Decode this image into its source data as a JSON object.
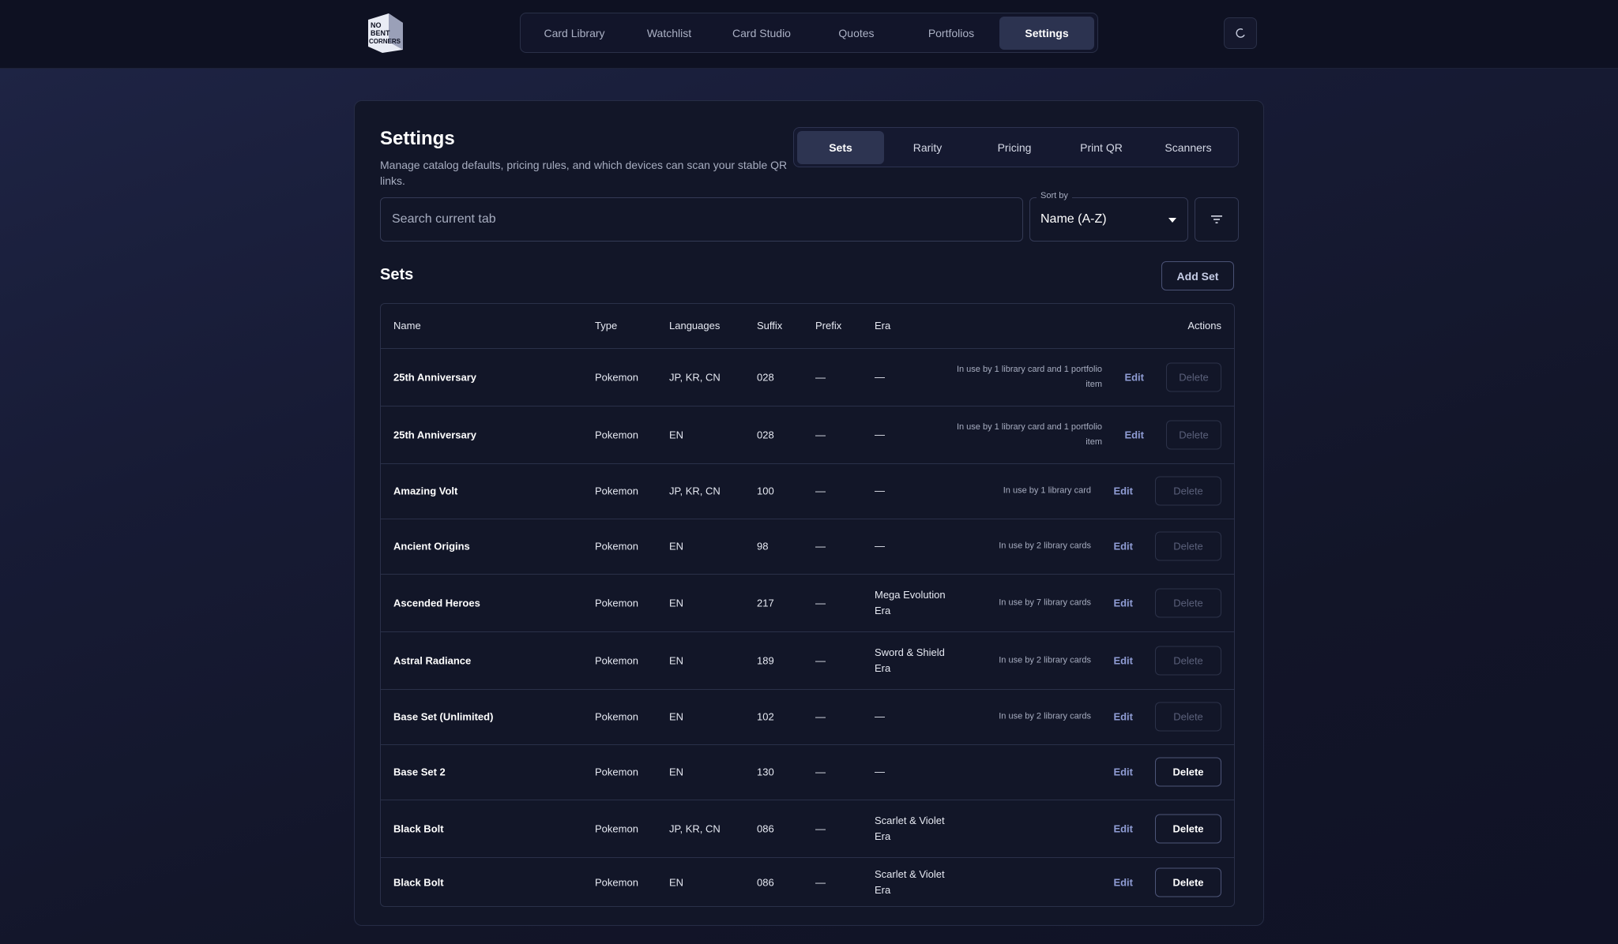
{
  "nav": {
    "items": [
      {
        "label": "Card Library",
        "name": "nav-card-library",
        "active": false
      },
      {
        "label": "Watchlist",
        "name": "nav-watchlist",
        "active": false
      },
      {
        "label": "Card Studio",
        "name": "nav-card-studio",
        "active": false
      },
      {
        "label": "Quotes",
        "name": "nav-quotes",
        "active": false
      },
      {
        "label": "Portfolios",
        "name": "nav-portfolios",
        "active": false
      },
      {
        "label": "Settings",
        "name": "nav-settings",
        "active": true
      }
    ],
    "theme_icon": "moon-icon"
  },
  "logo": {
    "lines": [
      "NO",
      "BENT",
      "CORNERS"
    ]
  },
  "header": {
    "title": "Settings",
    "subtitle": "Manage catalog defaults, pricing rules, and which devices can scan your stable QR links."
  },
  "tabs": [
    {
      "label": "Sets",
      "active": true
    },
    {
      "label": "Rarity",
      "active": false
    },
    {
      "label": "Pricing",
      "active": false
    },
    {
      "label": "Print QR",
      "active": false
    },
    {
      "label": "Scanners",
      "active": false
    }
  ],
  "search": {
    "placeholder": "Search current tab",
    "value": ""
  },
  "sort": {
    "label": "Sort by",
    "value": "Name (A-Z)"
  },
  "filter": {
    "icon": "filter-icon"
  },
  "section": {
    "title": "Sets",
    "add_label": "Add Set"
  },
  "table": {
    "headers": {
      "name": "Name",
      "type": "Type",
      "languages": "Languages",
      "suffix": "Suffix",
      "prefix": "Prefix",
      "era": "Era",
      "actions": "Actions"
    },
    "edit_label": "Edit",
    "delete_label": "Delete",
    "rows": [
      {
        "name": "25th Anniversary",
        "type": "Pokemon",
        "languages": "JP, KR, CN",
        "suffix": "028",
        "prefix": "—",
        "era": "—",
        "usage": "In use by 1 library card and 1 portfolio item",
        "delete_enabled": false
      },
      {
        "name": "25th Anniversary",
        "type": "Pokemon",
        "languages": "EN",
        "suffix": "028",
        "prefix": "—",
        "era": "—",
        "usage": "In use by 1 library card and 1 portfolio item",
        "delete_enabled": false
      },
      {
        "name": "Amazing Volt",
        "type": "Pokemon",
        "languages": "JP, KR, CN",
        "suffix": "100",
        "prefix": "—",
        "era": "—",
        "usage": "In use by 1 library card",
        "delete_enabled": false
      },
      {
        "name": "Ancient Origins",
        "type": "Pokemon",
        "languages": "EN",
        "suffix": "98",
        "prefix": "—",
        "era": "—",
        "usage": "In use by 2 library cards",
        "delete_enabled": false
      },
      {
        "name": "Ascended Heroes",
        "type": "Pokemon",
        "languages": "EN",
        "suffix": "217",
        "prefix": "—",
        "era": "Mega Evolution Era",
        "usage": "In use by 7 library cards",
        "delete_enabled": false
      },
      {
        "name": "Astral Radiance",
        "type": "Pokemon",
        "languages": "EN",
        "suffix": "189",
        "prefix": "—",
        "era": "Sword & Shield Era",
        "usage": "In use by 2 library cards",
        "delete_enabled": false
      },
      {
        "name": "Base Set (Unlimited)",
        "type": "Pokemon",
        "languages": "EN",
        "suffix": "102",
        "prefix": "—",
        "era": "—",
        "usage": "In use by 2 library cards",
        "delete_enabled": false
      },
      {
        "name": "Base Set 2",
        "type": "Pokemon",
        "languages": "EN",
        "suffix": "130",
        "prefix": "—",
        "era": "—",
        "usage": "",
        "delete_enabled": true
      },
      {
        "name": "Black Bolt",
        "type": "Pokemon",
        "languages": "JP, KR, CN",
        "suffix": "086",
        "prefix": "—",
        "era": "Scarlet & Violet Era",
        "usage": "",
        "delete_enabled": true
      },
      {
        "name": "Black Bolt",
        "type": "Pokemon",
        "languages": "EN",
        "suffix": "086",
        "prefix": "—",
        "era": "Scarlet & Violet Era",
        "usage": "",
        "delete_enabled": true
      }
    ]
  }
}
